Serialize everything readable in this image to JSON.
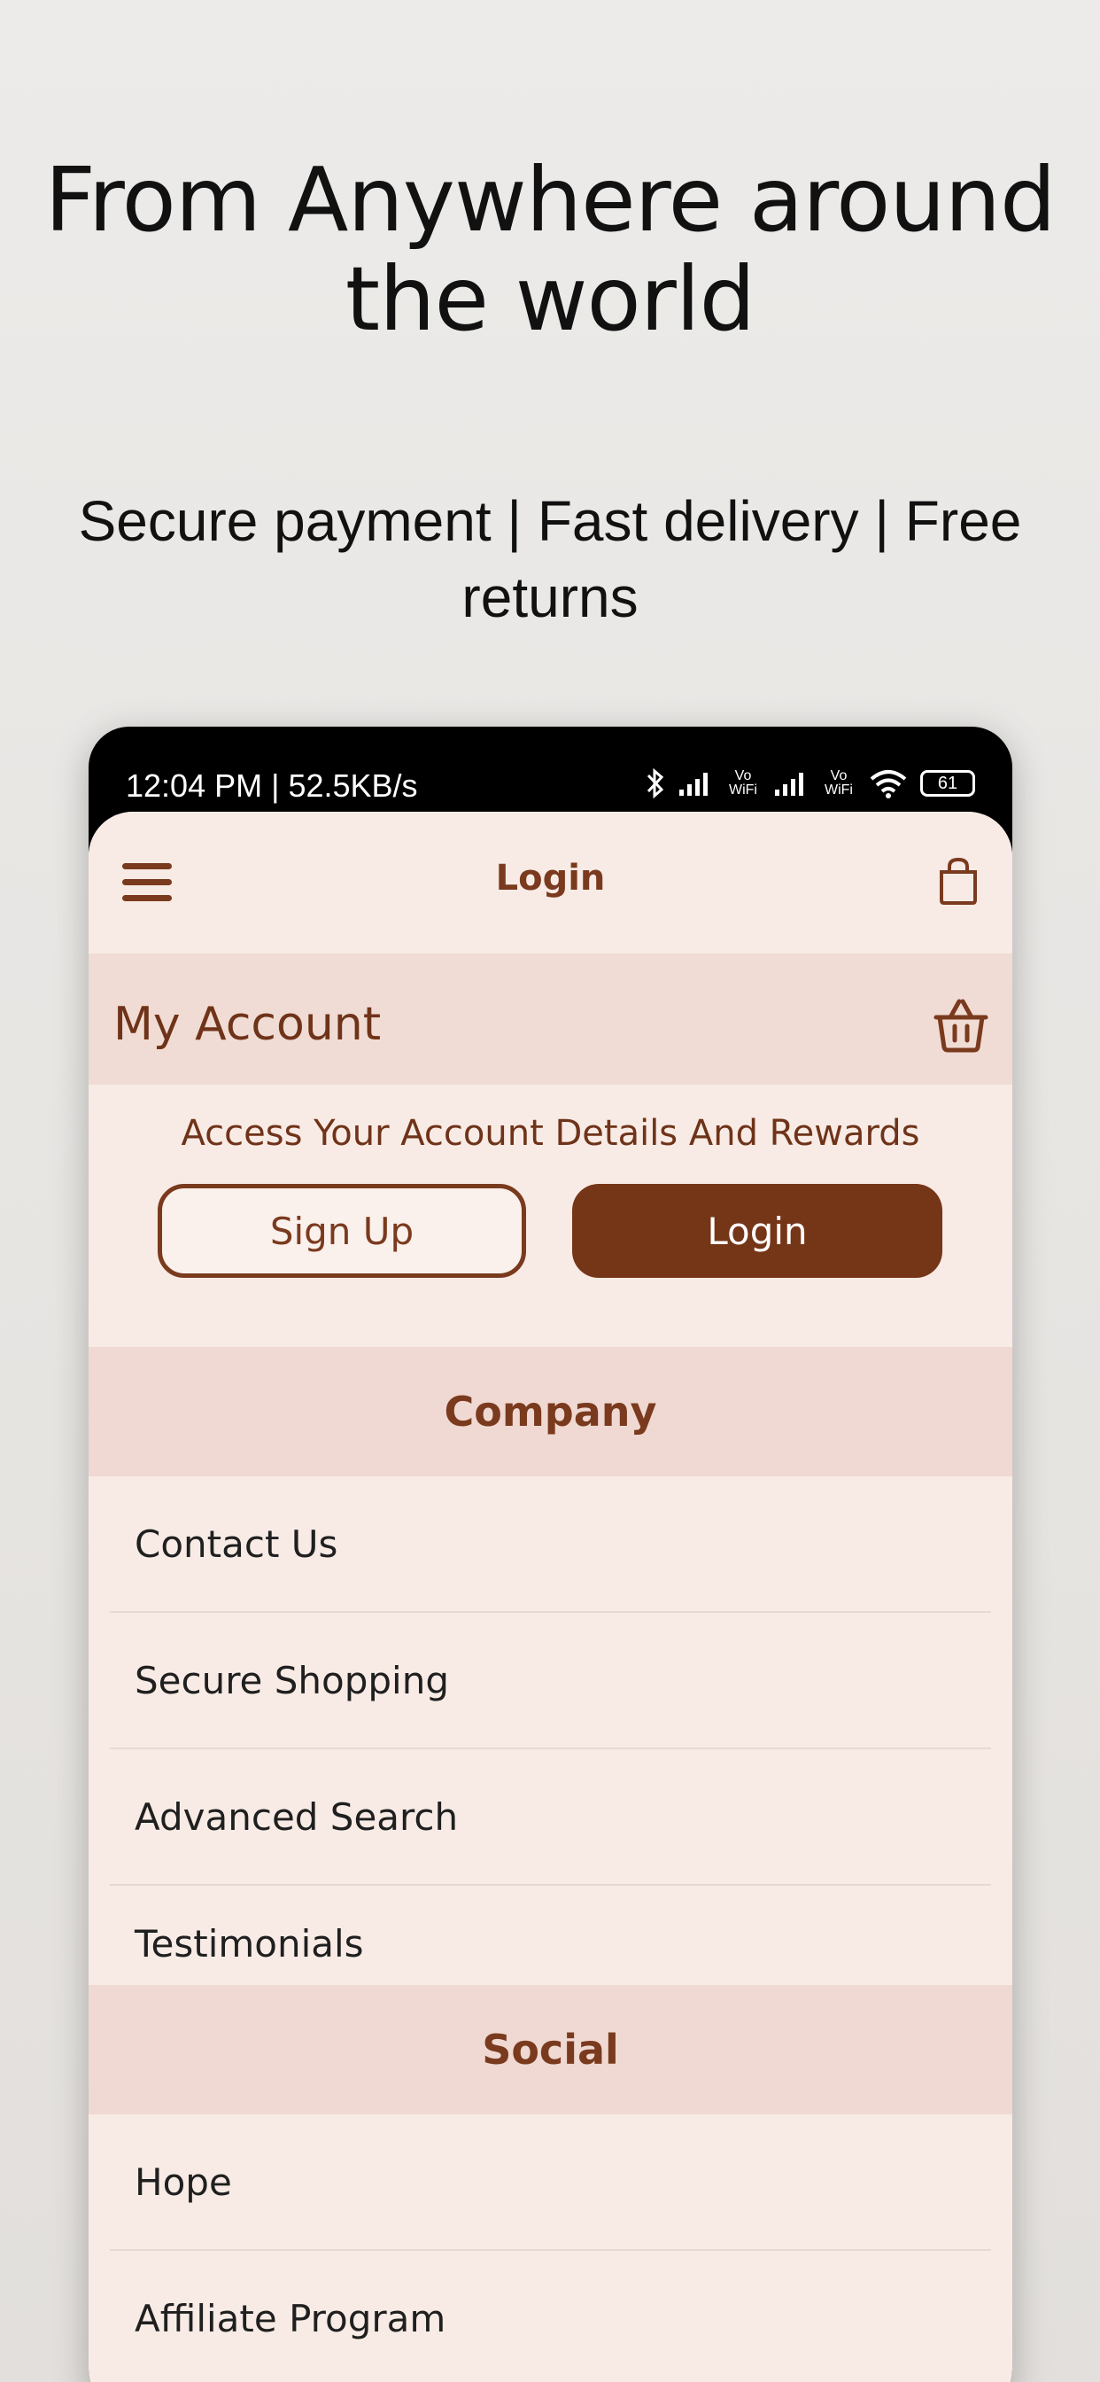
{
  "promo": {
    "headline": "From Anywhere around the world",
    "subline": "Secure payment | Fast delivery | Free returns"
  },
  "status_bar": {
    "time_text": "12:04 PM | 52.5KB/s",
    "battery": "61",
    "volte_label": "Vo WiFi"
  },
  "app_bar": {
    "title": "Login"
  },
  "account": {
    "title": "My Account",
    "description": "Access Your Account Details And Rewards",
    "signup_label": "Sign Up",
    "login_label": "Login"
  },
  "company": {
    "header": "Company",
    "items": [
      {
        "label": "Contact Us"
      },
      {
        "label": "Secure Shopping"
      },
      {
        "label": "Advanced Search"
      },
      {
        "label": "Testimonials"
      }
    ]
  },
  "social": {
    "header": "Social",
    "items": [
      {
        "label": "Hope"
      },
      {
        "label": "Affiliate Program"
      }
    ]
  },
  "colors": {
    "brand_brown": "#753517",
    "screen_bg": "#f8ebe5",
    "section_bg": "#efd9d2"
  },
  "icons": {
    "menu": "hamburger-menu-icon",
    "bag": "shopping-bag-icon",
    "basket": "basket-icon"
  }
}
